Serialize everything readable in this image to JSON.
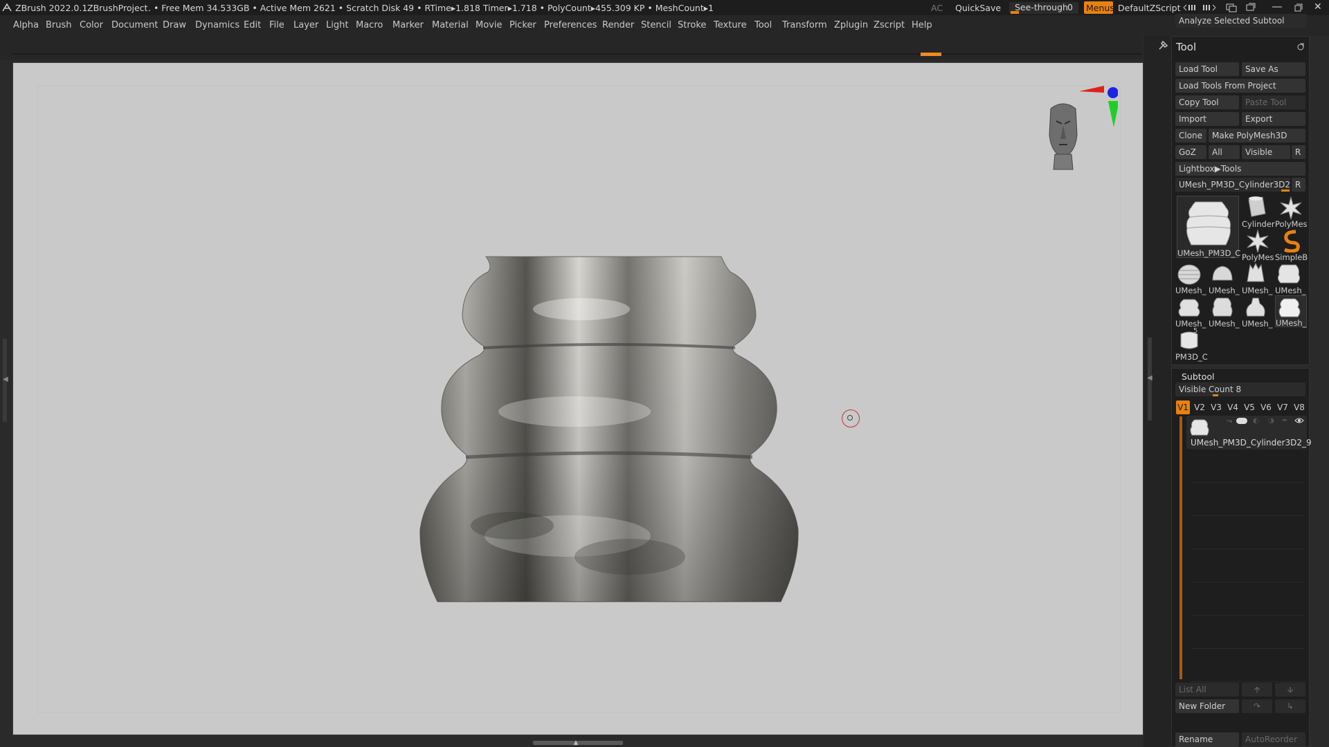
{
  "titlebar": {
    "app": "ZBrush 2022.0.1",
    "project": "ZBrushProject",
    "stats": ". • Free Mem 34.533GB • Active Mem 2621 • Scratch Disk 49 • RTime▸1.818 Timer▸1.718 • PolyCount▸455.309 KP • MeshCount▸1",
    "ac": "AC",
    "quicksave": "QuickSave",
    "seethrough": "See-through",
    "seethrough_value": "0",
    "menus": "Menus",
    "zscript": "DefaultZScript"
  },
  "menubar": [
    "Alpha",
    "Brush",
    "Color",
    "Document",
    "Draw",
    "Dynamics",
    "Edit",
    "File",
    "Layer",
    "Light",
    "Macro",
    "Marker",
    "Material",
    "Movie",
    "Picker",
    "Preferences",
    "Render",
    "Stencil",
    "Stroke",
    "Texture",
    "Tool",
    "Transform",
    "Zplugin",
    "Zscript",
    "Help"
  ],
  "tool_palette": {
    "analyze": "Analyze Selected Subtool",
    "title": "Tool",
    "load_tool": "Load Tool",
    "save_as": "Save As",
    "load_from_project": "Load Tools From Project",
    "copy_tool": "Copy Tool",
    "paste_tool": "Paste Tool",
    "import": "Import",
    "export": "Export",
    "clone": "Clone",
    "make_polymesh": "Make PolyMesh3D",
    "goz": "GoZ",
    "all": "All",
    "visible": "Visible",
    "r": "R",
    "lightbox_tools": "Lightbox▶Tools",
    "current_tool": "UMesh_PM3D_Cylinder3D2_9",
    "current_tool_r": "R",
    "main_thumb_label": "UMesh_PM3D_C",
    "thumbs": [
      {
        "label": "Cylinder",
        "icon": "cylinder-icon"
      },
      {
        "label": "PolyMes",
        "icon": "polymesh-star-icon"
      },
      {
        "label": "PolyMes",
        "icon": "polymesh-star-icon"
      },
      {
        "label": "SimpleB",
        "icon": "simplebrush-icon"
      },
      {
        "label": "UMesh_",
        "icon": "umesh-icon"
      },
      {
        "label": "UMesh_",
        "icon": "umesh-icon"
      },
      {
        "label": "UMesh_",
        "icon": "umesh-icon"
      },
      {
        "label": "UMesh_",
        "icon": "umesh-icon"
      },
      {
        "label": "UMesh_",
        "icon": "umesh-icon"
      },
      {
        "label": "UMesh_",
        "icon": "umesh-icon"
      },
      {
        "label": "UMesh_",
        "icon": "umesh-icon"
      },
      {
        "label": "UMesh_",
        "icon": "umesh-icon"
      },
      {
        "label": "PM3D_C",
        "icon": "pm3d-icon"
      }
    ],
    "thumb_count_badge": "5"
  },
  "subtool": {
    "title": "Subtool",
    "visible_count": "Visible Count 8",
    "versions": [
      "V1",
      "V2",
      "V3",
      "V4",
      "V5",
      "V6",
      "V7",
      "V8"
    ],
    "active_version": "V1",
    "item_name": "UMesh_PM3D_Cylinder3D2_9",
    "list_all": "List All",
    "new_folder": "New Folder",
    "rename": "Rename",
    "autoreorder": "AutoReorder"
  },
  "colors": {
    "accent": "#e8820e",
    "canvas": "#c9c9c9",
    "panel": "#1e1e1e"
  }
}
